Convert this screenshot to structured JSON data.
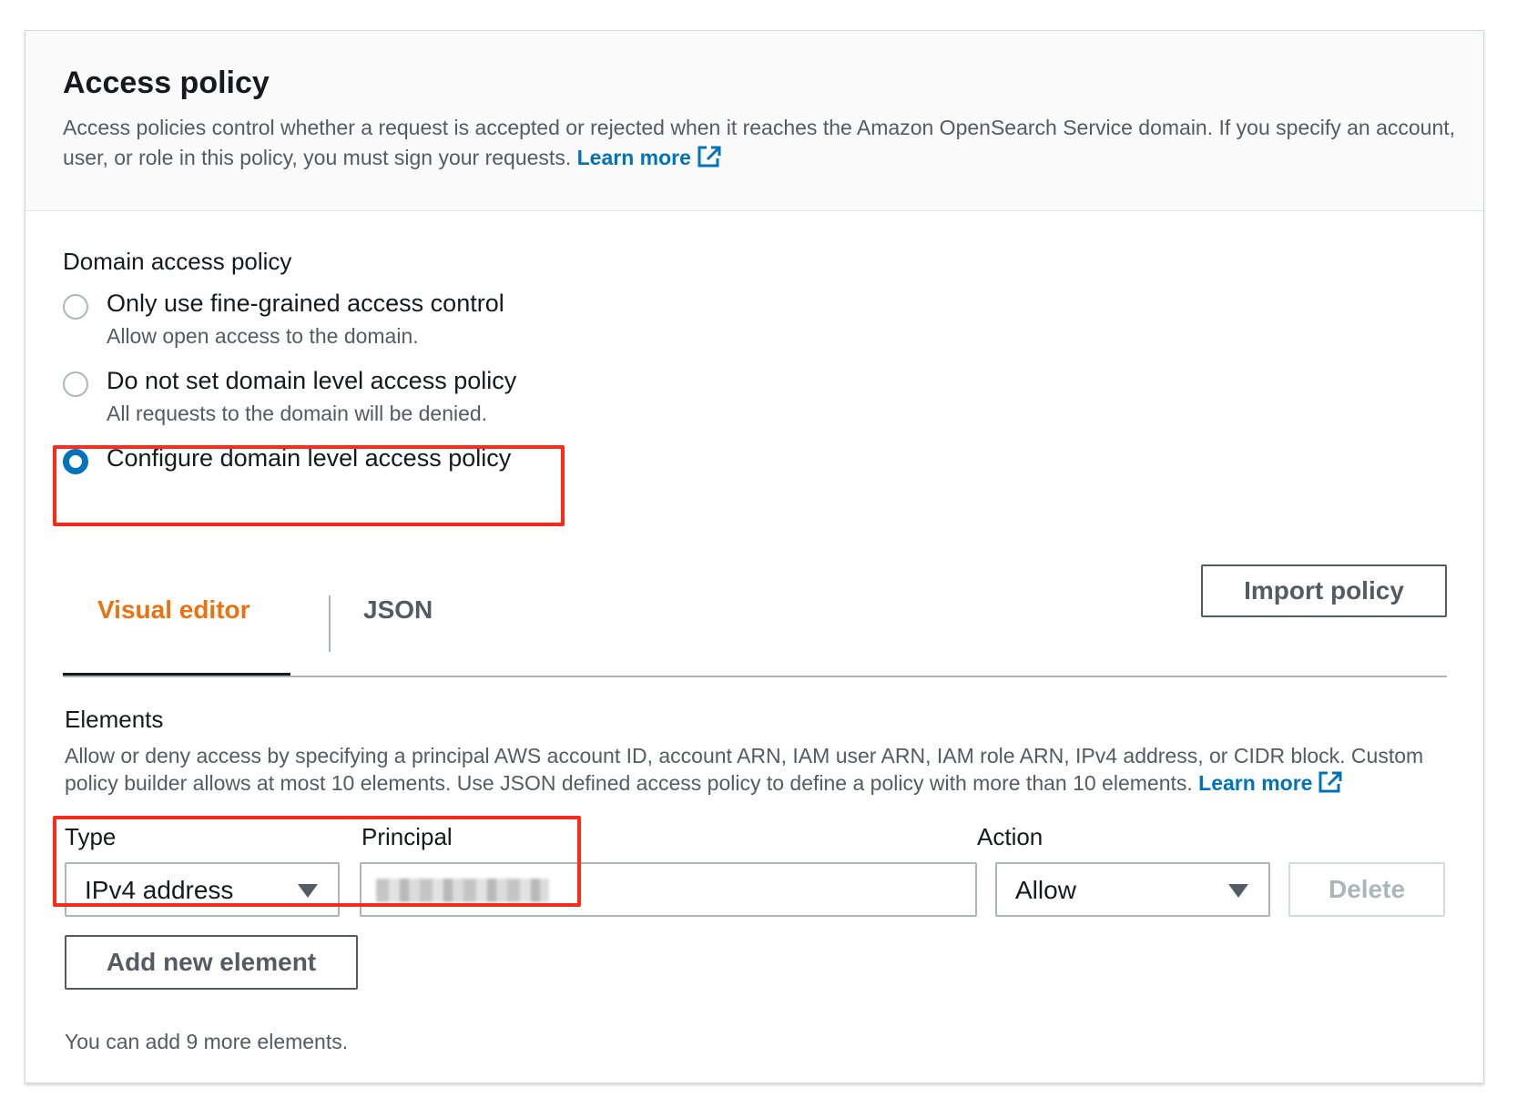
{
  "header": {
    "title": "Access policy",
    "description": "Access policies control whether a request is accepted or rejected when it reaches the Amazon OpenSearch Service domain. If you specify an account, user, or role in this policy, you must sign your requests.",
    "learn_more": "Learn more"
  },
  "domain_access": {
    "label": "Domain access policy",
    "options": [
      {
        "label": "Only use fine-grained access control",
        "description": "Allow open access to the domain.",
        "selected": false
      },
      {
        "label": "Do not set domain level access policy",
        "description": "All requests to the domain will be denied.",
        "selected": false
      },
      {
        "label": "Configure domain level access policy",
        "description": "",
        "selected": true
      }
    ]
  },
  "tabs": [
    {
      "label": "Visual editor",
      "active": true
    },
    {
      "label": "JSON",
      "active": false
    }
  ],
  "import_button": "Import policy",
  "elements": {
    "label": "Elements",
    "description": "Allow or deny access by specifying a principal AWS account ID, account ARN, IAM user ARN, IAM role ARN, IPv4 address, or CIDR block. Custom policy builder allows at most 10 elements. Use JSON defined access policy to define a policy with more than 10 elements.",
    "learn_more": "Learn more",
    "columns": {
      "type": "Type",
      "principal": "Principal",
      "action": "Action"
    },
    "row": {
      "type": "IPv4 address",
      "principal": "",
      "action": "Allow"
    },
    "delete_button": "Delete",
    "add_button": "Add new element",
    "helper": "You can add 9 more elements."
  },
  "colors": {
    "link": "#0073bb",
    "active_tab": "#ec7211",
    "selected_radio": "#0073bb",
    "highlight": "#ff2a1a"
  }
}
